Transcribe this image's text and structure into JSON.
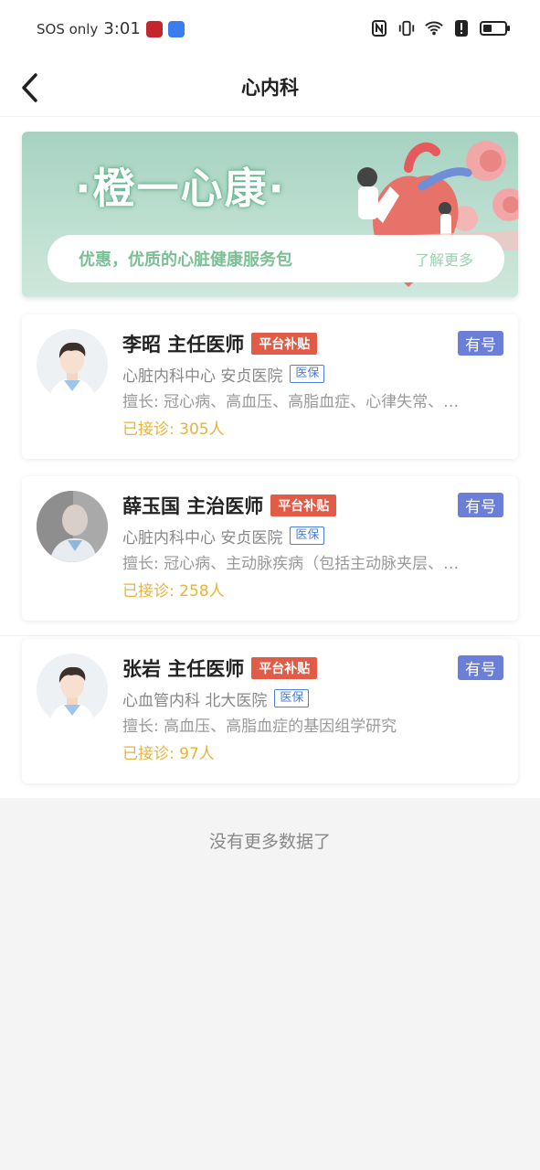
{
  "status_bar": {
    "carrier": "SOS only",
    "time": "3:01"
  },
  "nav": {
    "title": "心内科"
  },
  "banner": {
    "title": "·橙一心康·",
    "promo": "优惠，优质的心脏健康服务包",
    "more": "了解更多"
  },
  "doctors": [
    {
      "name": "李昭 主任医师",
      "subsidy": "平台补贴",
      "availability": "有号",
      "department": "心脏内科中心 安贞医院",
      "insurance": "医保",
      "specialty": "擅长: 冠心病、高血压、高脂血症、心律失常、…",
      "visits": "已接诊: 305人"
    },
    {
      "name": "薛玉国 主治医师",
      "subsidy": "平台补贴",
      "availability": "有号",
      "department": "心脏内科中心 安贞医院",
      "insurance": "医保",
      "specialty": "擅长: 冠心病、主动脉疾病（包括主动脉夹层、…",
      "visits": "已接诊: 258人"
    },
    {
      "name": "张岩 主任医师",
      "subsidy": "平台补贴",
      "availability": "有号",
      "department": "心血管内科 北大医院",
      "insurance": "医保",
      "specialty": "擅长: 高血压、高脂血症的基因组学研究",
      "visits": "已接诊: 97人"
    }
  ],
  "footer": {
    "no_more": "没有更多数据了"
  },
  "colors": {
    "subsidy": "#e25b46",
    "availability": "#6b7fd8",
    "visits": "#e8b33a",
    "insurance": "#4a7fd4"
  }
}
